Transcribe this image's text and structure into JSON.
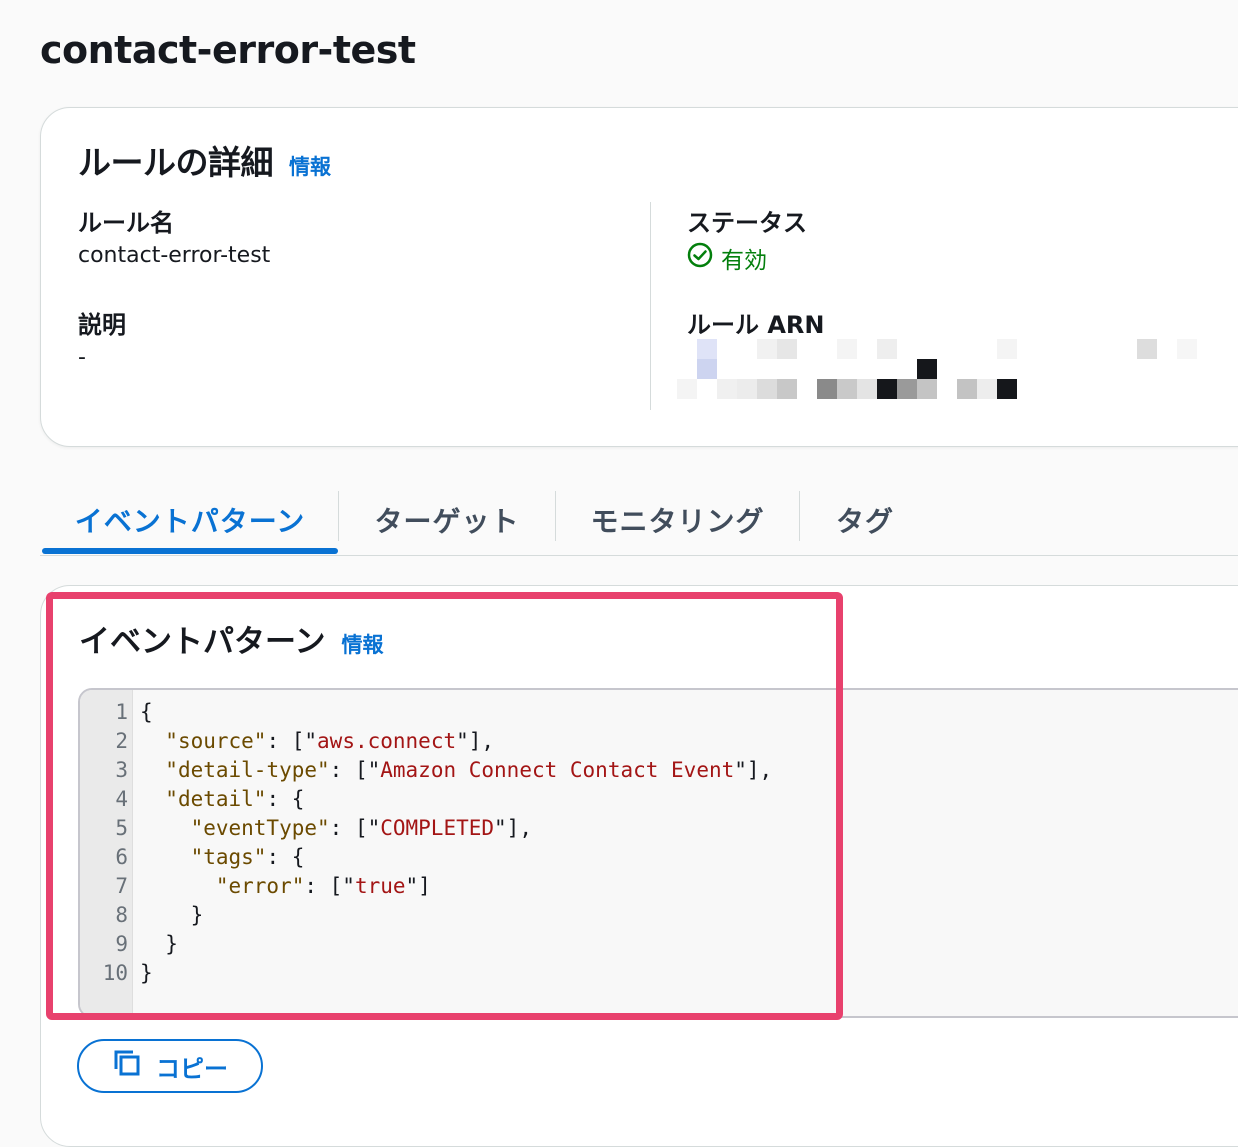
{
  "page": {
    "title": "contact-error-test"
  },
  "rule_details": {
    "title": "ルールの詳細",
    "info_link": "情報",
    "rule_name_label": "ルール名",
    "rule_name_value": "contact-error-test",
    "description_label": "説明",
    "description_value": "-",
    "status_label": "ステータス",
    "status_value": "有効",
    "status_color": "#037f0c",
    "arn_label": "ルール ARN",
    "arn_redacted": true
  },
  "tabs": [
    {
      "label": "イベントパターン",
      "active": true
    },
    {
      "label": "ターゲット",
      "active": false
    },
    {
      "label": "モニタリング",
      "active": false
    },
    {
      "label": "タグ",
      "active": false
    }
  ],
  "event_pattern": {
    "title": "イベントパターン",
    "info_link": "情報",
    "lines": [
      {
        "n": "1",
        "text": "{"
      },
      {
        "n": "2",
        "text": "  \"source\": [\"aws.connect\"],"
      },
      {
        "n": "3",
        "text": "  \"detail-type\": [\"Amazon Connect Contact Event\"],"
      },
      {
        "n": "4",
        "text": "  \"detail\": {"
      },
      {
        "n": "5",
        "text": "    \"eventType\": [\"COMPLETED\"],"
      },
      {
        "n": "6",
        "text": "    \"tags\": {"
      },
      {
        "n": "7",
        "text": "      \"error\": [\"true\"]"
      },
      {
        "n": "8",
        "text": "    }"
      },
      {
        "n": "9",
        "text": "  }"
      },
      {
        "n": "10",
        "text": "}"
      }
    ],
    "copy_button": "コピー"
  },
  "colors": {
    "accent": "#0972d3",
    "highlight": "#e8416d"
  }
}
